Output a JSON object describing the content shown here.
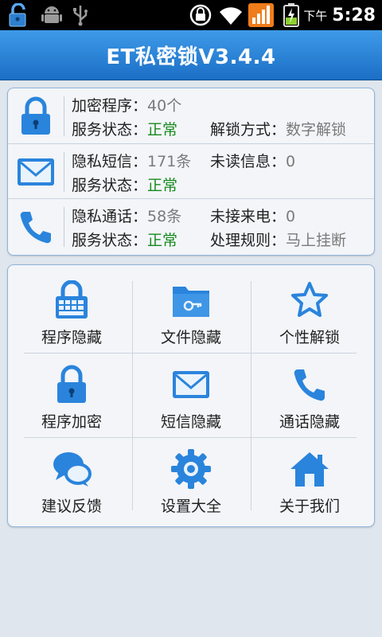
{
  "status_bar": {
    "ampm": "下午",
    "time": "5:28"
  },
  "app": {
    "title": "ET私密锁V3.4.4"
  },
  "info": {
    "programs": {
      "label": "加密程序：",
      "value": "40个",
      "status_label": "服务状态：",
      "status_value": "正常",
      "extra_label": "解锁方式：",
      "extra_value": "数字解锁"
    },
    "sms": {
      "label": "隐私短信：",
      "value": "171条",
      "extra_label": "未读信息：",
      "extra_value": "0",
      "status_label": "服务状态：",
      "status_value": "正常"
    },
    "calls": {
      "label": "隐私通话：",
      "value": "58条",
      "extra_label": "未接来电：",
      "extra_value": "0",
      "status_label": "服务状态：",
      "status_value": "正常",
      "rule_label": "处理规则：",
      "rule_value": "马上挂断"
    }
  },
  "menu": [
    {
      "label": "程序隐藏",
      "icon": "keyboard-lock-icon"
    },
    {
      "label": "文件隐藏",
      "icon": "folder-key-icon"
    },
    {
      "label": "个性解锁",
      "icon": "star-icon"
    },
    {
      "label": "程序加密",
      "icon": "padlock-icon"
    },
    {
      "label": "短信隐藏",
      "icon": "envelope-icon"
    },
    {
      "label": "通话隐藏",
      "icon": "phone-icon"
    },
    {
      "label": "建议反馈",
      "icon": "chat-bubbles-icon"
    },
    {
      "label": "设置大全",
      "icon": "gear-icon"
    },
    {
      "label": "关于我们",
      "icon": "house-icon"
    }
  ],
  "colors": {
    "accent": "#2a84dc",
    "status_ok": "#178a1e",
    "value_gray": "#7a7a7a"
  }
}
